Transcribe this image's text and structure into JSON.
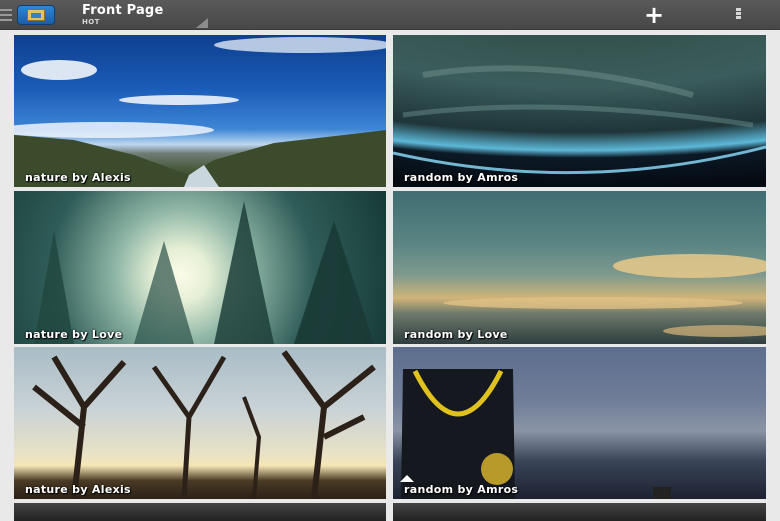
{
  "actionbar": {
    "title": "Front Page",
    "subtitle": "HOT",
    "add_icon": "plus-icon",
    "add_glyph": "+",
    "overflow_icon": "overflow-menu-icon",
    "logo_icon": "app-logo-icon"
  },
  "grid": {
    "tiles": [
      {
        "caption": "nature by Alexis"
      },
      {
        "caption": "random by Amros"
      },
      {
        "caption": "nature by Love"
      },
      {
        "caption": "random by Love"
      },
      {
        "caption": "nature by Alexis"
      },
      {
        "caption": "random by Amros"
      }
    ]
  },
  "colors": {
    "actionbar": "#4f4f4f",
    "background": "#e9e9e9",
    "caption_text": "#ffffff"
  }
}
